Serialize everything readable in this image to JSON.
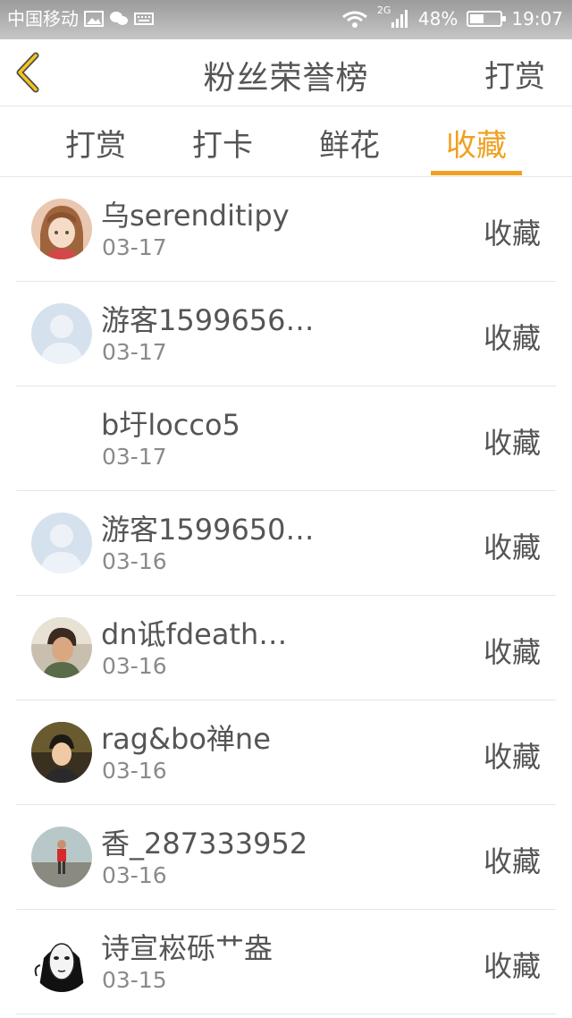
{
  "status_bar": {
    "carrier": "中国移动",
    "network": "2G",
    "battery_percent": "48%",
    "battery_level": 0.48,
    "time": "19:07"
  },
  "header": {
    "title": "粉丝荣誉榜",
    "action_label": "打赏",
    "back_icon": "chevron-left-icon",
    "accent_color": "#f0a020"
  },
  "tabs": [
    {
      "label": "打赏"
    },
    {
      "label": "打卡"
    },
    {
      "label": "鲜花"
    },
    {
      "label": "收藏"
    }
  ],
  "active_tab": "收藏",
  "fans": [
    {
      "name": "乌serenditipy",
      "date": "03-17",
      "action": "收藏",
      "avatar": "anime-girl"
    },
    {
      "name": "游客1599656…",
      "date": "03-17",
      "action": "收藏",
      "avatar": "default"
    },
    {
      "name": "b圩locco5",
      "date": "03-17",
      "action": "收藏",
      "avatar": "none"
    },
    {
      "name": "游客1599650…",
      "date": "03-16",
      "action": "收藏",
      "avatar": "default"
    },
    {
      "name": "dn诋fdeath…",
      "date": "03-16",
      "action": "收藏",
      "avatar": "photo-man"
    },
    {
      "name": "rag&bo禅ne",
      "date": "03-16",
      "action": "收藏",
      "avatar": "photo-boy"
    },
    {
      "name": "香_287333952",
      "date": "03-16",
      "action": "收藏",
      "avatar": "photo-outdoor"
    },
    {
      "name": "诗宣崧砾艹盎",
      "date": "03-15",
      "action": "收藏",
      "avatar": "mask-cartoon"
    }
  ]
}
